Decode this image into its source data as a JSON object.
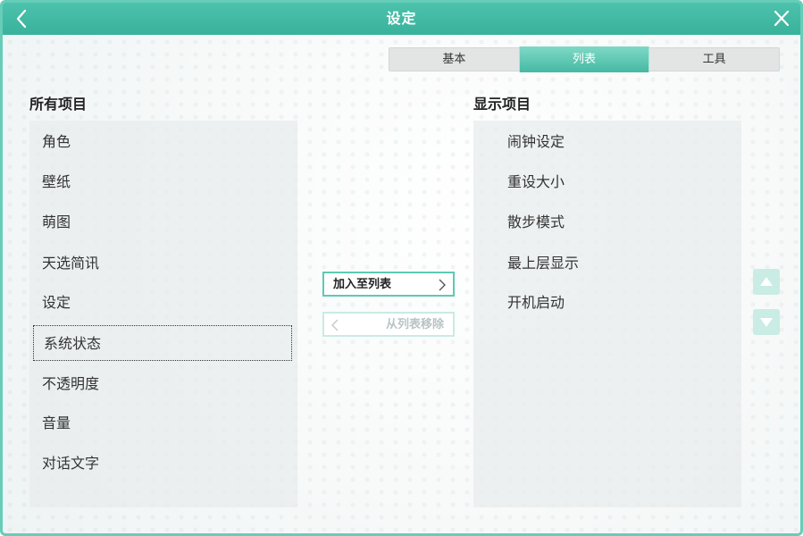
{
  "window": {
    "title": "设定"
  },
  "tabs": [
    {
      "label": "基本",
      "active": false
    },
    {
      "label": "列表",
      "active": true
    },
    {
      "label": "工具",
      "active": false
    }
  ],
  "all_items": {
    "title": "所有项目",
    "items": [
      "角色",
      "壁纸",
      "萌图",
      "天选简讯",
      "设定",
      "系统状态",
      "不透明度",
      "音量",
      "对话文字"
    ],
    "selected": "系统状态"
  },
  "shown_items": {
    "title": "显示项目",
    "items": [
      "闹钟设定",
      "重设大小",
      "散步模式",
      "最上层显示",
      "开机启动"
    ]
  },
  "buttons": {
    "add": "加入至列表",
    "remove": "从列表移除"
  },
  "colors": {
    "accent": "#45b9a3",
    "title_bar": "#3fb7a0",
    "selected_row": "#d3ebe6",
    "order_button": "#c9ece4"
  },
  "icons": {
    "back": "chevron-left-icon",
    "close": "close-icon",
    "add": "chevron-right-icon",
    "remove": "chevron-left-icon",
    "move_up": "triangle-up-icon",
    "move_down": "triangle-down-icon"
  }
}
